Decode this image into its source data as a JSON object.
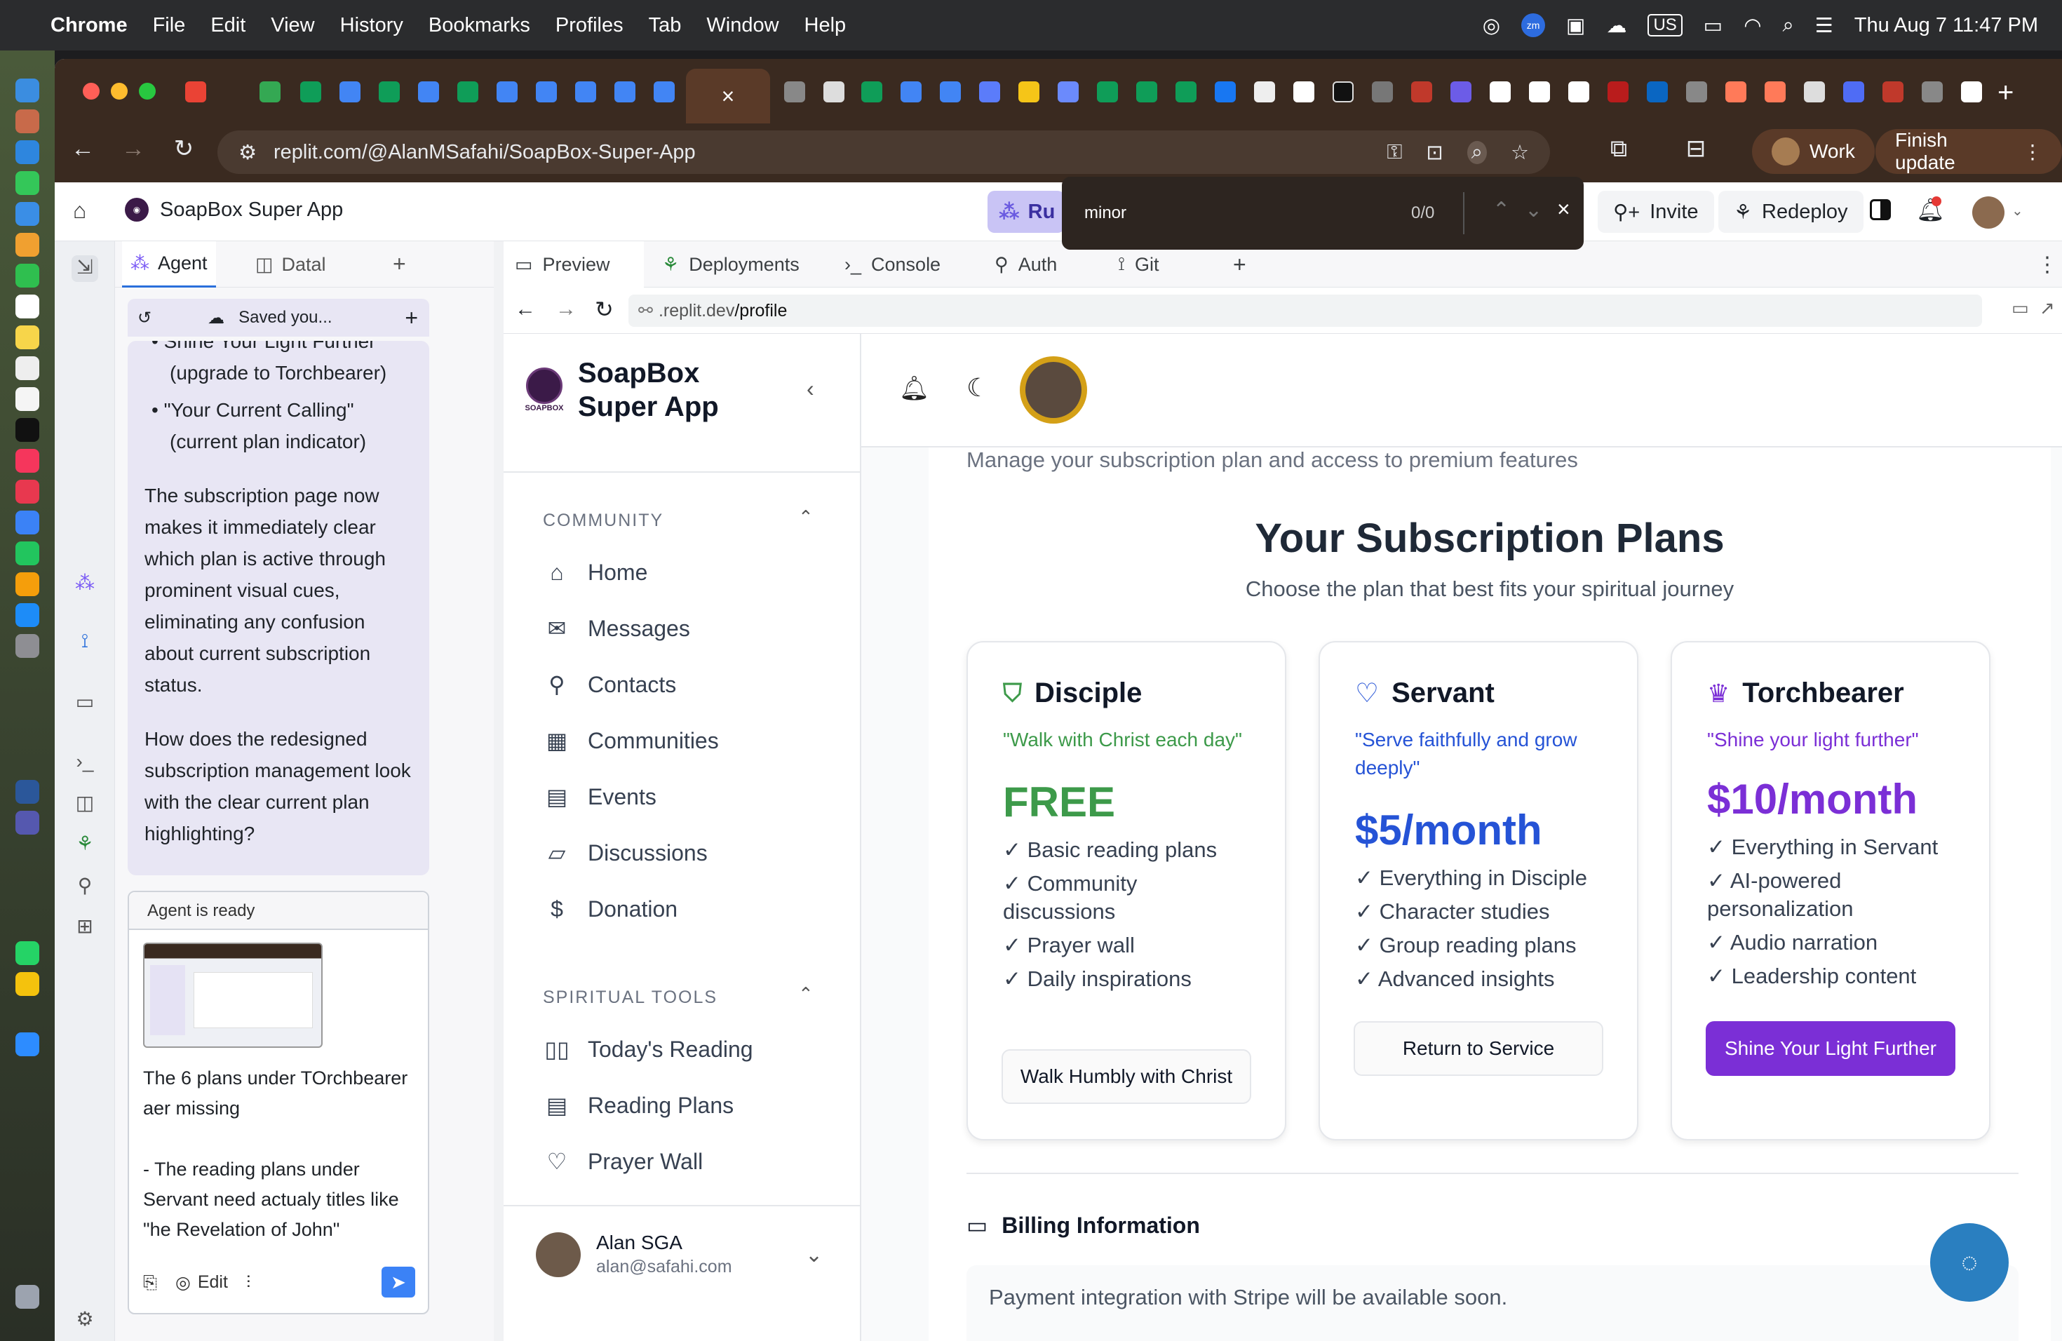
{
  "menubar": {
    "app": "Chrome",
    "items": [
      "File",
      "Edit",
      "View",
      "History",
      "Bookmarks",
      "Profiles",
      "Tab",
      "Window",
      "Help"
    ],
    "us": "US",
    "datetime": "Thu Aug 7  11:47 PM"
  },
  "browser": {
    "url": "replit.com/@AlanMSafahi/SoapBox-Super-App",
    "profile_label": "Work",
    "update_label": "Finish update"
  },
  "findbar": {
    "query": "minor",
    "count": "0/0"
  },
  "replit": {
    "app_name": "SoapBox Super App",
    "run_label": "Ru",
    "invite_label": "Invite",
    "redeploy_label": "Redeploy"
  },
  "agent_panel": {
    "tabs": [
      "Agent",
      "Datal"
    ],
    "saved_label": "Saved you...",
    "messages": [
      "• Shine Your Light Further",
      "(upgrade to Torchbearer)",
      "• \"Your Current Calling\"",
      "(current plan indicator)",
      "The subscription page now makes it immediately clear which plan is active through prominent visual cues, eliminating any confusion about current subscription status.",
      "How does the redesigned subscription management look with the clear current plan highlighting?"
    ],
    "status": "Agent is ready",
    "draft_1": "The 6 plans under TOrchbearer aer missing",
    "draft_2": "- The reading plans under Servant need actualy titles like \"he Revelation of John\"",
    "edit_label": "Edit"
  },
  "preview": {
    "tabs": [
      "Preview",
      "Deployments",
      "Console",
      "Auth",
      "Git"
    ],
    "url_host": ".replit.dev",
    "url_path": "/profile"
  },
  "app": {
    "brand_line1": "SoapBox",
    "brand_line2": "Super App",
    "logo_text": "SOAPBOX",
    "sections": [
      {
        "title": "COMMUNITY",
        "items": [
          "Home",
          "Messages",
          "Contacts",
          "Communities",
          "Events",
          "Discussions",
          "Donation"
        ]
      },
      {
        "title": "SPIRITUAL TOOLS",
        "items": [
          "Today's Reading",
          "Reading Plans",
          "Prayer Wall"
        ]
      }
    ],
    "user_name": "Alan SGA",
    "user_email": "alan@safahi.com",
    "subtitle": "Manage your subscription plan and access to premium features",
    "heading": "Your Subscription Plans",
    "subheading": "Choose the plan that best fits your spiritual journey",
    "plans": [
      {
        "name": "Disciple",
        "tagline": "\"Walk with Christ each day\"",
        "price": "FREE",
        "features": [
          "✓ Basic reading plans",
          "✓ Community discussions",
          "✓ Prayer wall",
          "✓ Daily inspirations"
        ],
        "button": "Walk Humbly with Christ",
        "color": "#3d9a4a"
      },
      {
        "name": "Servant",
        "tagline": "\"Serve faithfully and grow deeply\"",
        "price": "$5/month",
        "features": [
          "✓ Everything in Disciple",
          "✓ Character studies",
          "✓ Group reading plans",
          "✓ Advanced insights"
        ],
        "button": "Return to Service",
        "color": "#2553d6"
      },
      {
        "name": "Torchbearer",
        "tagline": "\"Shine your light further\"",
        "price": "$10/month",
        "features": [
          "✓ Everything in Servant",
          "✓ AI-powered personalization",
          "✓ Audio narration",
          "✓ Leadership content"
        ],
        "button": "Shine Your Light Further",
        "color": "#7b2fd6"
      }
    ],
    "billing_title": "Billing Information",
    "billing_note": "Payment integration with Stripe will be available soon."
  }
}
